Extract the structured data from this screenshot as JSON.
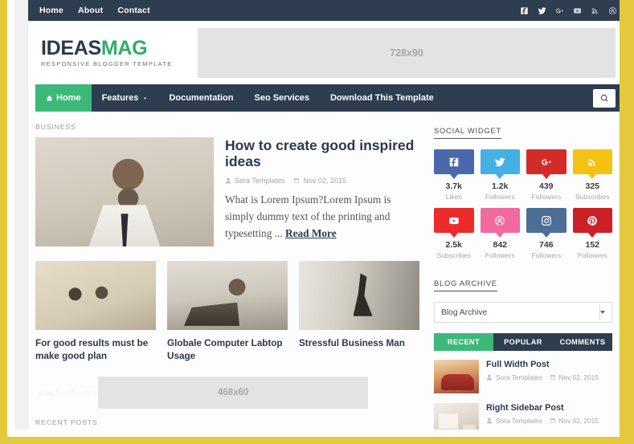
{
  "topbar": {
    "nav": [
      {
        "label": "Home"
      },
      {
        "label": "About"
      },
      {
        "label": "Contact"
      }
    ],
    "social": [
      {
        "name": "facebook-icon"
      },
      {
        "name": "twitter-icon"
      },
      {
        "name": "google-plus-icon"
      },
      {
        "name": "youtube-icon"
      },
      {
        "name": "rss-icon"
      },
      {
        "name": "dribbble-icon"
      }
    ]
  },
  "header": {
    "logo_primary": "IDEAS",
    "logo_secondary": "MAG",
    "logo_tagline": "RESPONSIVE BLOGGER TEMPLATE",
    "ad_label": "728x90"
  },
  "mainnav": {
    "items": [
      {
        "label": "Home",
        "active": true,
        "icon": "home-icon"
      },
      {
        "label": "Features",
        "active": false,
        "caret": true
      },
      {
        "label": "Documentation",
        "active": false
      },
      {
        "label": "Seo Services",
        "active": false
      },
      {
        "label": "Download This Template",
        "active": false
      }
    ],
    "search_icon": "search-icon"
  },
  "main": {
    "section_label": "BUSINESS",
    "featured": {
      "title": "How to create good inspired ideas",
      "author": "Sora Templates",
      "date": "Nov 02, 2015",
      "excerpt": "What is Lorem Ipsum?Lorem Ipsum is simply dummy text of the printing and typesetting ... ",
      "read_more": "Read More"
    },
    "cards": [
      {
        "title": "For good results must be make good plan"
      },
      {
        "title": "Globale Computer Labtop Usage"
      },
      {
        "title": "Stressful Business Man"
      }
    ],
    "ad_label": "468x60",
    "watermark": "www.bestfreetemplate.com",
    "recent_posts_label": "RECENT POSTS"
  },
  "sidebar": {
    "social_widget_title": "SOCIAL WIDGET",
    "social_tiles": [
      {
        "icon": "facebook-icon",
        "count": "3.7k",
        "label": "Likes",
        "color": "#4a69ad"
      },
      {
        "icon": "twitter-icon",
        "count": "1.2k",
        "label": "Followers",
        "color": "#45b0e3"
      },
      {
        "icon": "google-plus-icon",
        "count": "439",
        "label": "Followers",
        "color": "#d32c28"
      },
      {
        "icon": "rss-icon",
        "count": "325",
        "label": "Subscribes",
        "color": "#f5c112"
      },
      {
        "icon": "youtube-icon",
        "count": "2.5k",
        "label": "Subscribes",
        "color": "#ed2b2b"
      },
      {
        "icon": "dribbble-icon",
        "count": "842",
        "label": "Followers",
        "color": "#f0699f"
      },
      {
        "icon": "instagram-icon",
        "count": "746",
        "label": "Followers",
        "color": "#4d6e96"
      },
      {
        "icon": "pinterest-icon",
        "count": "152",
        "label": "Followers",
        "color": "#cd1f26"
      }
    ],
    "archive_title": "BLOG ARCHIVE",
    "archive_selected": "Blog Archive",
    "tabs": [
      {
        "label": "RECENT",
        "active": true
      },
      {
        "label": "POPULAR",
        "active": false
      },
      {
        "label": "COMMENTS",
        "active": false
      }
    ],
    "posts": [
      {
        "title": "Full Width Post",
        "author": "Sora Templates",
        "date": "Nov 02, 2015"
      },
      {
        "title": "Right Sidebar Post",
        "author": "Sora Templates",
        "date": "Nov 02, 2015"
      }
    ]
  },
  "colors": {
    "navy": "#2e3d4f",
    "green": "#3cb878",
    "frame_gold": "#e3c93b",
    "page_bg": "#f1f1f1"
  }
}
